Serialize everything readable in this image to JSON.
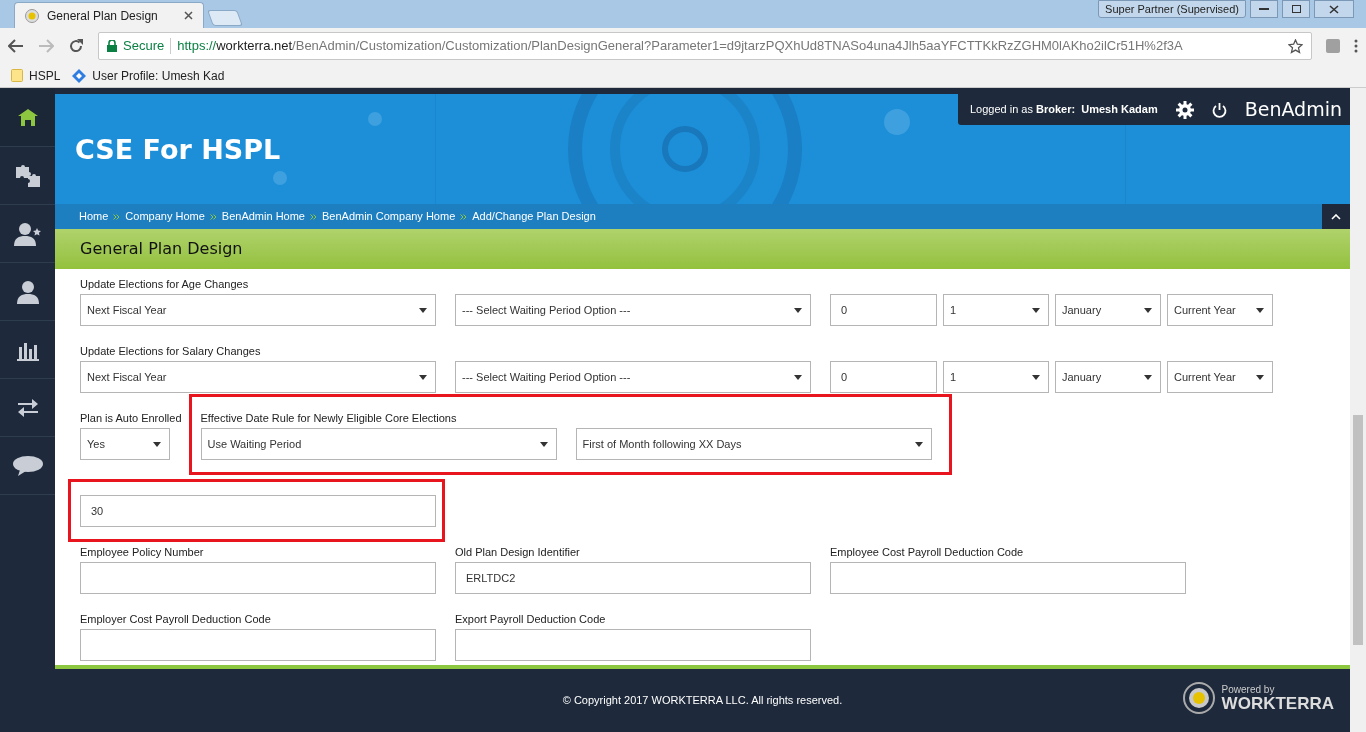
{
  "browser": {
    "tab_title": "General Plan Design",
    "profile": "Super Partner (Supervised)",
    "secure_label": "Secure",
    "url_scheme": "https://",
    "url_host": "workterra.net",
    "url_path": "/BenAdmin/Customization/Customization/PlanDesignGeneral?Parameter1=d9jtarzPQXhUd8TNASo4una4Jlh5aaYFCTTKkRzZGHM0lAKho2ilCr51H%2f3A",
    "bookmarks": [
      {
        "kind": "folder",
        "label": "HSPL"
      },
      {
        "kind": "link",
        "label": "User Profile: Umesh Kad"
      }
    ]
  },
  "sidebar": {
    "items": [
      {
        "kind": "home",
        "selected": true
      },
      {
        "kind": "puzzle",
        "selected": false
      },
      {
        "kind": "person-star",
        "selected": false
      },
      {
        "kind": "person",
        "selected": false
      },
      {
        "kind": "chart",
        "selected": false
      },
      {
        "kind": "arrows",
        "selected": false
      },
      {
        "kind": "chat",
        "selected": false
      }
    ]
  },
  "header": {
    "company": "CSE For HSPL",
    "logged_in_prefix": "Logged in as",
    "role": "Broker:",
    "user": "Umesh Kadam",
    "app": "BenAdmin",
    "breadcrumbs": [
      "Home",
      "Company Home",
      "BenAdmin Home",
      "BenAdmin Company Home",
      "Add/Change Plan Design"
    ]
  },
  "section_title": "General Plan Design",
  "rows": [
    {
      "cells": [
        {
          "label": "Update Elections for Age Changes",
          "highlighted": false,
          "controls": [
            {
              "kind": "select",
              "value": "Next Fiscal Year"
            }
          ]
        },
        {
          "highlighted": false,
          "controls": [
            {
              "kind": "select",
              "value": "--- Select Waiting Period Option ---"
            }
          ]
        },
        {
          "highlighted": false,
          "controls": [
            {
              "kind": "mini-text",
              "value": "0"
            },
            {
              "kind": "mini-select",
              "value": "1"
            },
            {
              "kind": "mini-select",
              "value": "January"
            },
            {
              "kind": "mini-select",
              "value": "Current Year"
            }
          ]
        }
      ]
    },
    {
      "cells": [
        {
          "label": "Update Elections for Salary Changes",
          "highlighted": false,
          "controls": [
            {
              "kind": "select",
              "value": "Next Fiscal Year"
            }
          ]
        },
        {
          "highlighted": false,
          "controls": [
            {
              "kind": "select",
              "value": "--- Select Waiting Period Option ---"
            }
          ]
        },
        {
          "highlighted": false,
          "controls": [
            {
              "kind": "mini-text",
              "value": "0"
            },
            {
              "kind": "mini-select",
              "value": "1"
            },
            {
              "kind": "mini-select",
              "value": "January"
            },
            {
              "kind": "mini-select",
              "value": "Current Year"
            }
          ]
        }
      ]
    },
    {
      "cells": [
        {
          "label": "Plan is Auto Enrolled",
          "highlighted": false,
          "controls": [
            {
              "kind": "small-select",
              "value": "Yes"
            }
          ]
        },
        {
          "label": "Effective Date Rule for Newly Eligible Core Elections",
          "highlighted": true,
          "controls": [
            {
              "kind": "select",
              "value": "Use Waiting Period"
            },
            {
              "kind": "select",
              "value": "First of Month following XX Days"
            }
          ]
        }
      ]
    },
    {
      "cells": [
        {
          "highlighted": true,
          "controls": [
            {
              "kind": "text",
              "value": "30"
            }
          ]
        }
      ]
    },
    {
      "cells": [
        {
          "label": "Employee Policy Number",
          "highlighted": false,
          "controls": [
            {
              "kind": "text"
            }
          ]
        },
        {
          "label": "Old Plan Design Identifier",
          "highlighted": false,
          "controls": [
            {
              "kind": "text",
              "value": "ERLTDC2"
            }
          ]
        },
        {
          "label": "Employee Cost Payroll Deduction Code",
          "highlighted": false,
          "controls": [
            {
              "kind": "text"
            }
          ]
        }
      ]
    },
    {
      "cells": [
        {
          "label": "Employer Cost Payroll Deduction Code",
          "highlighted": false,
          "controls": [
            {
              "kind": "text"
            }
          ]
        },
        {
          "label": "Export Payroll Deduction Code",
          "highlighted": false,
          "controls": [
            {
              "kind": "text"
            }
          ]
        }
      ]
    }
  ],
  "footer": {
    "copyright": "© Copyright 2017 WORKTERRA LLC. All rights reserved.",
    "powered_by": "Powered by",
    "brand": "WORKTERRA"
  }
}
